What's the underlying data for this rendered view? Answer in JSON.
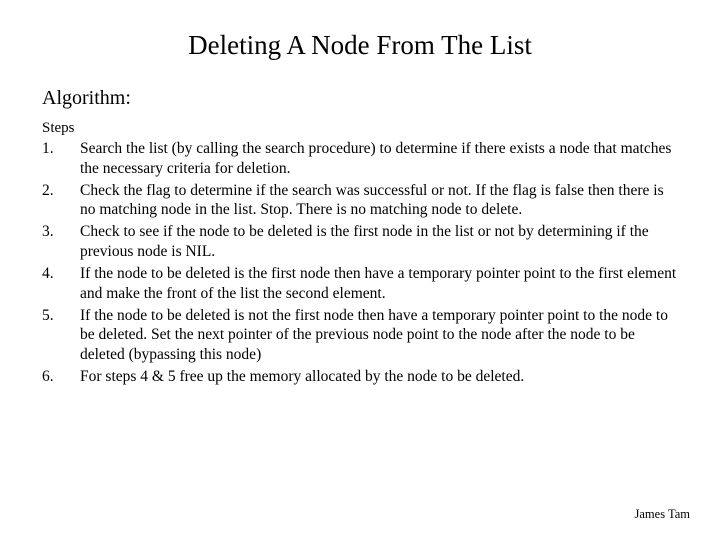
{
  "title": "Deleting A Node From The List",
  "section_label": "Algorithm:",
  "steps_label": "Steps",
  "steps": [
    {
      "num": "1.",
      "text": "Search the list (by calling the search procedure) to determine if there exists a node that matches the necessary criteria for deletion."
    },
    {
      "num": "2.",
      "text": "Check the flag to determine if the search was successful or not.  If the flag is false then there is no matching node in the list.  Stop.  There is no matching node to delete."
    },
    {
      "num": "3.",
      "text": "Check to see if the node to be deleted is the first node in the list or not by determining if the previous node is NIL."
    },
    {
      "num": "4.",
      "text": "If the node to be deleted is the first node then have a temporary pointer point to the first element and make the front of the list the second element."
    },
    {
      "num": "5.",
      "text": "If the node to be deleted is not the first node then have a temporary pointer point to the node to be deleted.  Set the next pointer of the previous node point to the node after the node to be deleted (bypassing this node)"
    },
    {
      "num": "6.",
      "text": "For steps 4 & 5 free up the memory allocated by the node to be deleted."
    }
  ],
  "footer_author": "James Tam"
}
